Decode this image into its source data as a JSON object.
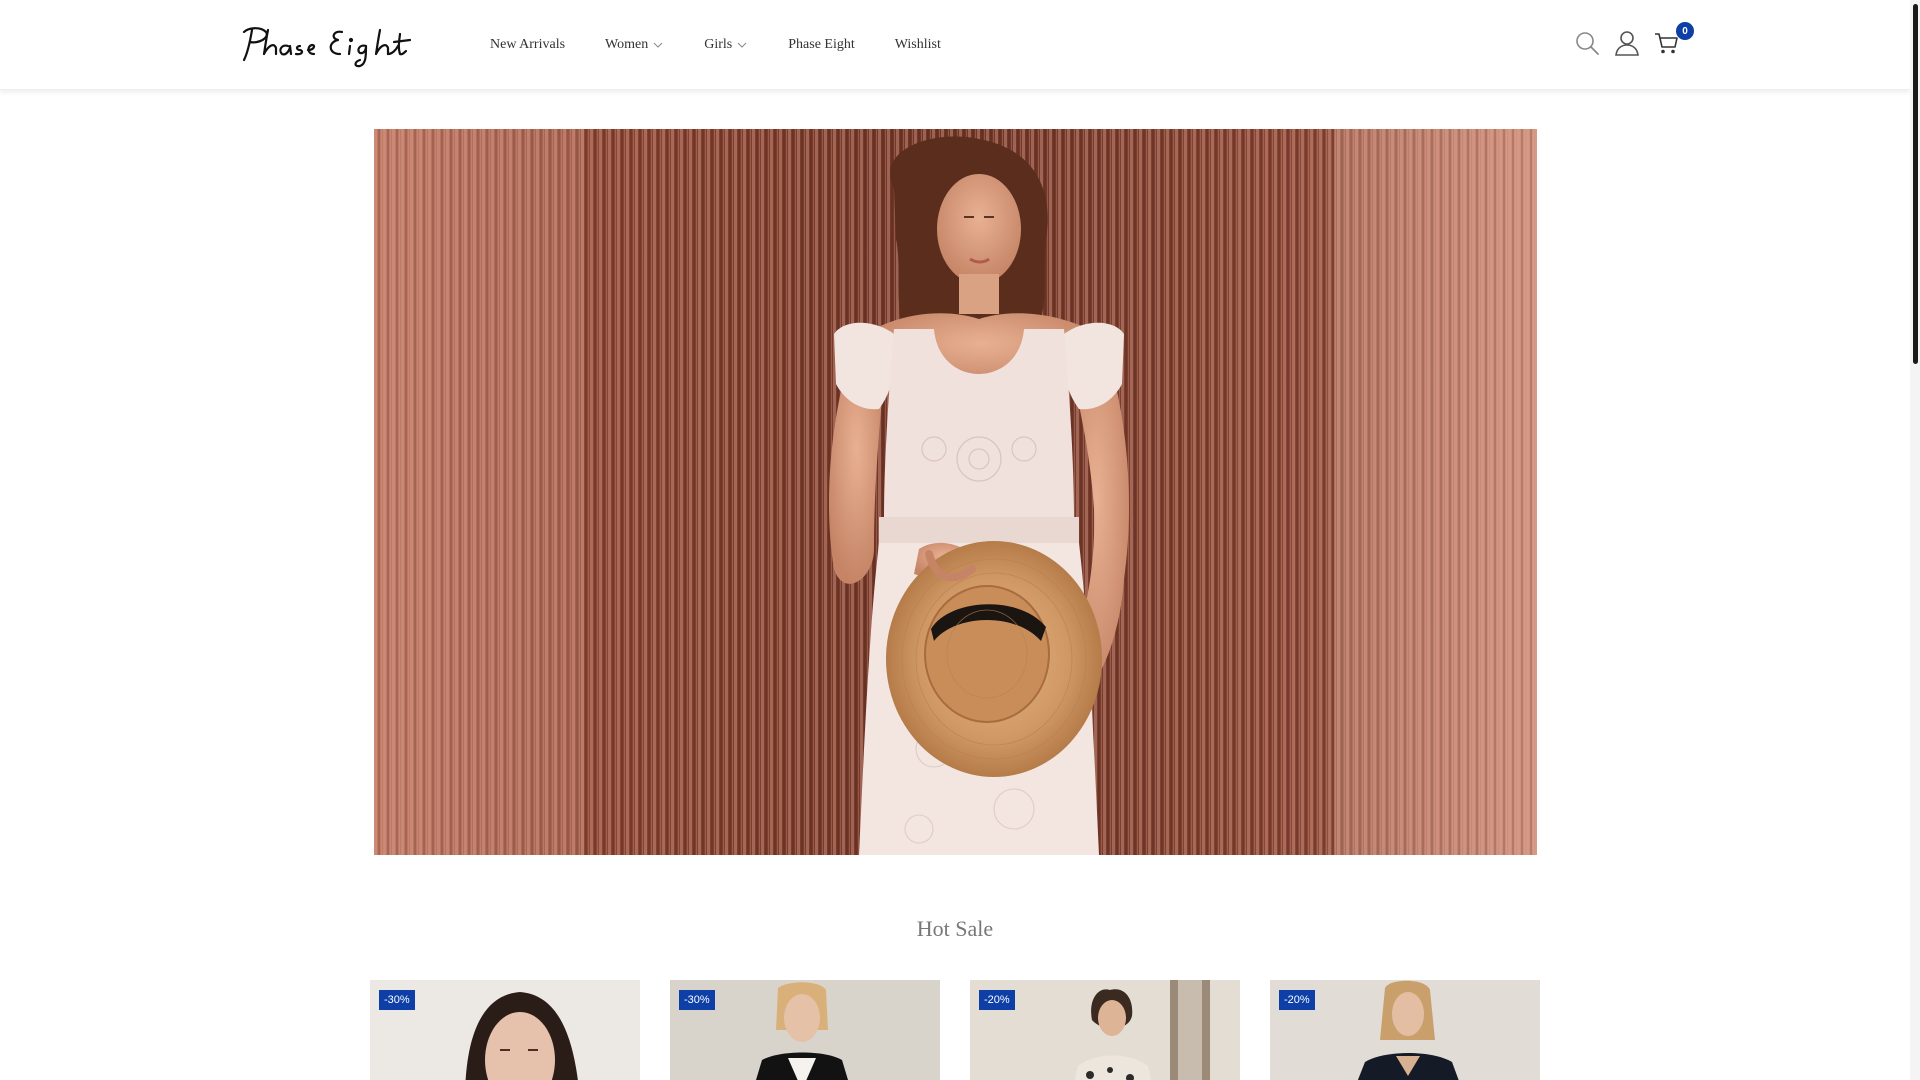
{
  "brand": {
    "logo_text": "Phase Eight"
  },
  "nav": {
    "items": [
      {
        "label": "New Arrivals",
        "has_dropdown": false
      },
      {
        "label": "Women",
        "has_dropdown": true
      },
      {
        "label": "Girls",
        "has_dropdown": true
      },
      {
        "label": "Phase Eight",
        "has_dropdown": false
      },
      {
        "label": "Wishlist",
        "has_dropdown": false
      }
    ]
  },
  "header_icons": {
    "search": "search-icon",
    "account": "user-icon",
    "cart": "cart-icon",
    "cart_count": "0"
  },
  "hero": {
    "image": "woman-in-white-lace-dress-holding-straw-hat"
  },
  "hot_sale": {
    "title": "Hot Sale",
    "products": [
      {
        "discount": "-30%",
        "image": "woman-dark-hair-portrait"
      },
      {
        "discount": "-30%",
        "image": "woman-black-blazer"
      },
      {
        "discount": "-20%",
        "image": "woman-floral-top"
      },
      {
        "discount": "-20%",
        "image": "woman-navy-dress"
      }
    ]
  },
  "colors": {
    "accent": "#0d3fa6",
    "text": "#333333",
    "section_title": "#777777"
  }
}
